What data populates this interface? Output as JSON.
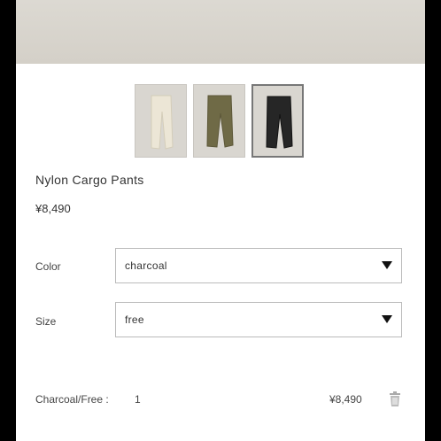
{
  "product": {
    "name": "Nylon Cargo Pants",
    "price": "¥8,490"
  },
  "thumbnails": [
    {
      "name": "ivory",
      "color": "#e6e0cf"
    },
    {
      "name": "olive",
      "color": "#7a7550"
    },
    {
      "name": "charcoal",
      "color": "#2a2a2a",
      "selected": true
    }
  ],
  "options": {
    "color": {
      "label": "Color",
      "value": "charcoal"
    },
    "size": {
      "label": "Size",
      "value": "free"
    }
  },
  "line_item": {
    "variant": "Charcoal/Free :",
    "quantity": "1",
    "amount": "¥8,490"
  },
  "icons": {
    "dropdown": "triangle-down-icon",
    "delete": "trash-icon"
  }
}
